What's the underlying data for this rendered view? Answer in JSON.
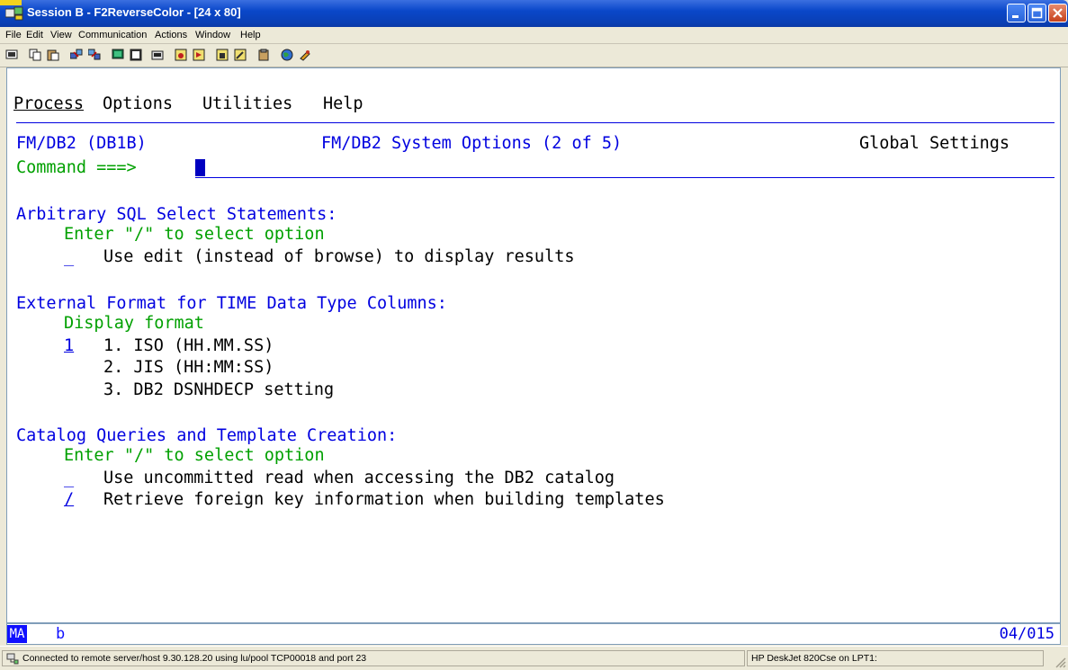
{
  "window": {
    "title": "Session B - F2ReverseColor - [24 x 80]",
    "buttons": {
      "minimize": "minimize-icon",
      "maximize": "maximize-icon",
      "close": "close-icon"
    }
  },
  "menubar": {
    "items": [
      "File",
      "Edit",
      "View",
      "Communication",
      "Actions",
      "Window",
      "Help"
    ]
  },
  "toolbar": {
    "icons": [
      "print-screen-icon",
      "copy-icon",
      "paste-icon",
      "send-file-icon",
      "receive-file-icon",
      "display-icon",
      "keypad-icon",
      "color-map-icon",
      "macro-record-icon",
      "macro-play-icon",
      "macro-stop-icon",
      "macro-edit-icon",
      "clipboard-icon",
      "globe-icon",
      "key-icon"
    ]
  },
  "terminal": {
    "action_bar": {
      "process": "Process",
      "options": "Options",
      "utilities": "Utilities",
      "help": "Help"
    },
    "header_left": "FM/DB2 (DB1B)",
    "header_title": "FM/DB2 System Options (2 of 5)",
    "header_right": "Global Settings",
    "command_label": "Command ===>",
    "section1": {
      "heading": "Arbitrary SQL Select Statements:",
      "instruction": "Enter \"/\" to select option",
      "option1_value": "_",
      "option1_label": "Use edit (instead of browse) to display results"
    },
    "section2": {
      "heading": "External Format for TIME Data Type Columns:",
      "instruction": "Display format",
      "value": "1",
      "choice1": "1. ISO (HH.MM.SS)",
      "choice2": "2. JIS (HH:MM:SS)",
      "choice3": "3. DB2 DSNHDECP setting"
    },
    "section3": {
      "heading": "Catalog Queries and Template Creation:",
      "instruction": "Enter \"/\" to select option",
      "option1_value": "_",
      "option1_label": "Use uncommitted read when accessing the DB2 catalog",
      "option2_value": "/",
      "option2_label": "Retrieve foreign key information when building templates"
    }
  },
  "oia": {
    "indicator": "MA",
    "mode": "b",
    "cursor_position": "04/015"
  },
  "statusbar": {
    "connection": "Connected to remote server/host 9.30.128.20 using lu/pool TCP00018 and port 23",
    "printer": "HP DeskJet 820Cse on LPT1:"
  },
  "colors": {
    "terminal_blue": "#0000e0",
    "terminal_green": "#00a000",
    "titlebar": "#0a47c9"
  }
}
